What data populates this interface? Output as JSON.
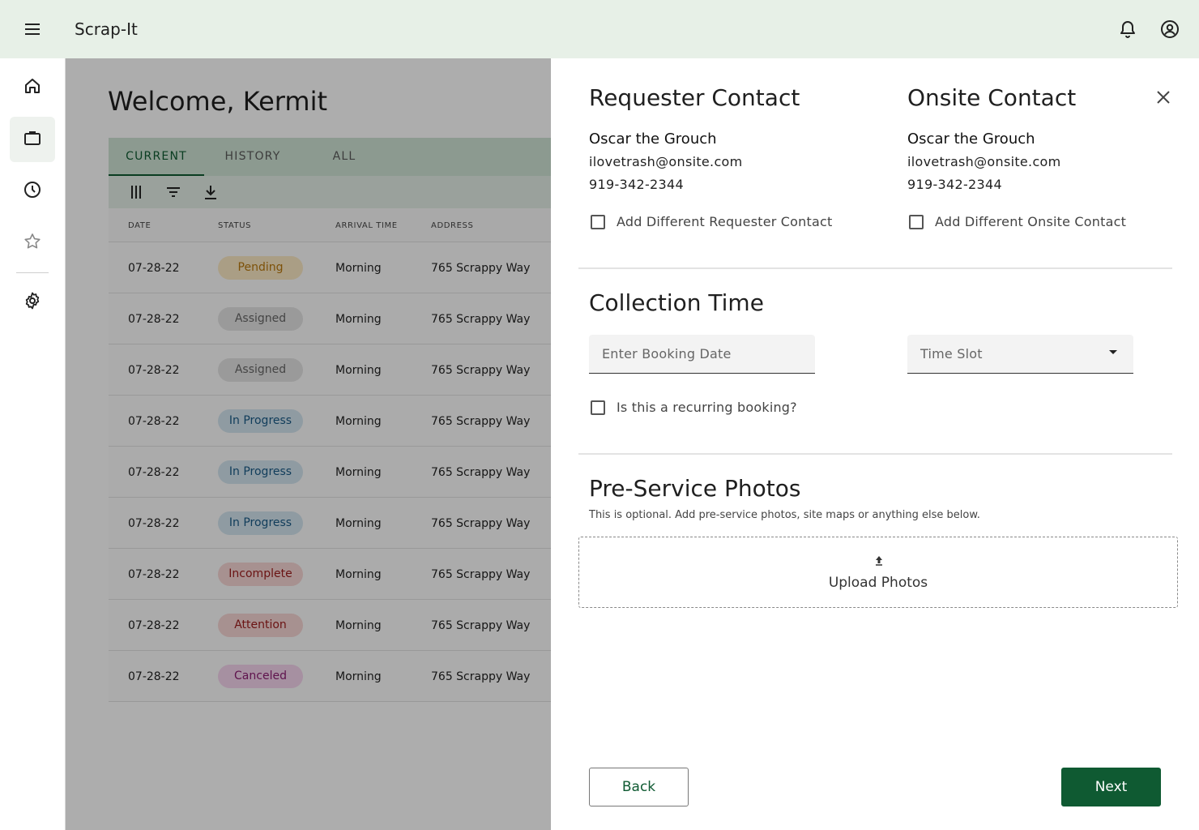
{
  "app": {
    "title": "Scrap-It"
  },
  "main": {
    "welcome": "Welcome, Kermit",
    "tabs": [
      {
        "label": "CURRENT"
      },
      {
        "label": "HISTORY"
      },
      {
        "label": "ALL"
      }
    ],
    "columns": [
      "DATE",
      "STATUS",
      "ARRIVAL TIME",
      "ADDRESS"
    ],
    "rows": [
      {
        "date": "07-28-22",
        "status": "Pending",
        "arrival": "Morning",
        "address": "765 Scrappy Way"
      },
      {
        "date": "07-28-22",
        "status": "Assigned",
        "arrival": "Morning",
        "address": "765 Scrappy Way"
      },
      {
        "date": "07-28-22",
        "status": "Assigned",
        "arrival": "Morning",
        "address": "765 Scrappy Way"
      },
      {
        "date": "07-28-22",
        "status": "In Progress",
        "arrival": "Morning",
        "address": "765 Scrappy Way"
      },
      {
        "date": "07-28-22",
        "status": "In Progress",
        "arrival": "Morning",
        "address": "765 Scrappy Way"
      },
      {
        "date": "07-28-22",
        "status": "In Progress",
        "arrival": "Morning",
        "address": "765 Scrappy Way"
      },
      {
        "date": "07-28-22",
        "status": "Incomplete",
        "arrival": "Morning",
        "address": "765 Scrappy Way"
      },
      {
        "date": "07-28-22",
        "status": "Attention",
        "arrival": "Morning",
        "address": "765 Scrappy Way"
      },
      {
        "date": "07-28-22",
        "status": "Canceled",
        "arrival": "Morning",
        "address": "765 Scrappy Way"
      }
    ],
    "status_colors": {
      "Pending": {
        "bg": "#fbe9c5",
        "fg": "#b9780d"
      },
      "Assigned": {
        "bg": "#e3e3e3",
        "fg": "#666666"
      },
      "In Progress": {
        "bg": "#d3e5ef",
        "fg": "#1a5a86"
      },
      "Incomplete": {
        "bg": "#f7d6d4",
        "fg": "#9c1c1c"
      },
      "Attention": {
        "bg": "#f7d6d4",
        "fg": "#9c1c1c"
      },
      "Canceled": {
        "bg": "#f5d4ee",
        "fg": "#8c1d72"
      }
    }
  },
  "panel": {
    "requester": {
      "heading": "Requester Contact",
      "name": "Oscar the Grouch",
      "email": "ilovetrash@onsite.com",
      "phone": "919-342-2344",
      "checkbox_label": "Add Different Requester Contact"
    },
    "onsite": {
      "heading": "Onsite Contact",
      "name": "Oscar the Grouch",
      "email": "ilovetrash@onsite.com",
      "phone": "919-342-2344",
      "checkbox_label": "Add Different Onsite Contact"
    },
    "collection": {
      "heading": "Collection Time",
      "date_placeholder": "Enter Booking Date",
      "time_slot_placeholder": "Time Slot",
      "recurring_label": "Is this a recurring booking?"
    },
    "photos": {
      "heading": "Pre-Service Photos",
      "hint": "This is optional. Add pre-service photos, site maps or anything else below.",
      "upload_label": "Upload Photos"
    },
    "back_label": "Back",
    "next_label": "Next"
  },
  "icons": {
    "menu": "menu-icon",
    "bell": "bell-icon",
    "account": "account-circle-icon",
    "home": "home-icon",
    "briefcase": "briefcase-icon",
    "clock": "clock-icon",
    "star": "star-icon",
    "settings": "gear-icon",
    "close": "close-icon",
    "columns": "columns-icon",
    "filter": "filter-icon",
    "download": "download-icon",
    "upload": "upload-icon"
  },
  "colors": {
    "brand_green": "#0f5a32",
    "topbar_bg": "#e7f0e7",
    "tabs_bg": "#cfe3d4"
  }
}
